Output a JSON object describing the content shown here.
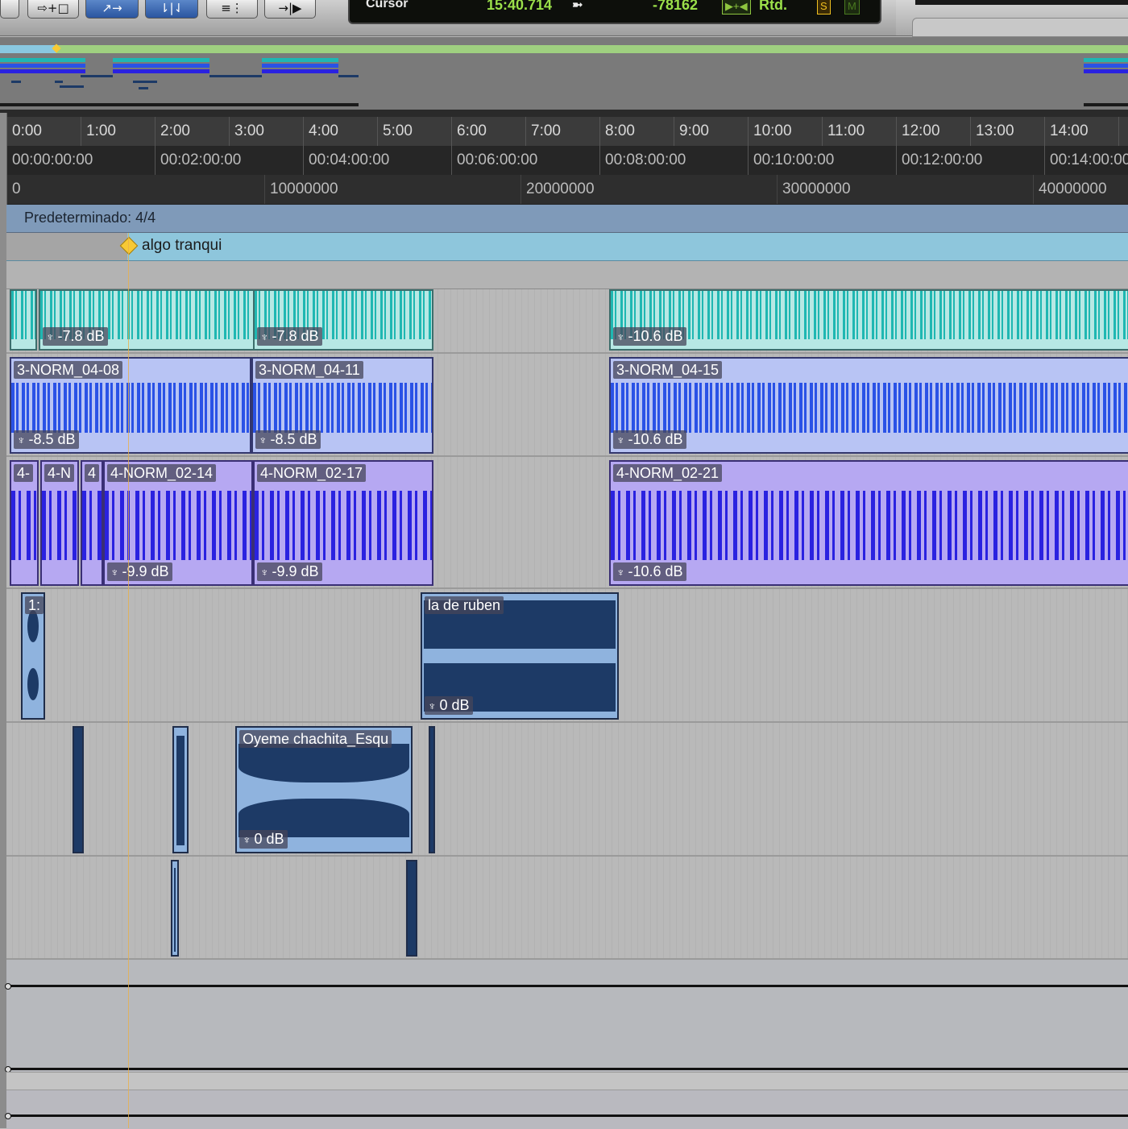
{
  "toolbar": {
    "buttons": [
      "⇨+□",
      "↗→",
      "⇂|⇃",
      "≡⋮",
      "→|▶"
    ]
  },
  "counter": {
    "label": "Cursor",
    "time": "15:40.714",
    "sample_value": "-78162",
    "badge_1": "▶+◀",
    "rtd": "Rtd.",
    "badge_s": "S",
    "badge_m": "M"
  },
  "rulers": {
    "minsecs": [
      "0:00",
      "1:00",
      "2:00",
      "3:00",
      "4:00",
      "5:00",
      "6:00",
      "7:00",
      "8:00",
      "9:00",
      "10:00",
      "11:00",
      "12:00",
      "13:00",
      "14:00"
    ],
    "timecode": [
      "00:00:00:00",
      "00:02:00:00",
      "00:04:00:00",
      "00:06:00:00",
      "00:08:00:00",
      "00:10:00:00",
      "00:12:00:00",
      "00:14:00:00"
    ],
    "samples": [
      "0",
      "10000000",
      "20000000",
      "30000000",
      "40000000"
    ]
  },
  "meter": "Predeterminado: 4/4",
  "marker": "algo tranqui",
  "tracks": {
    "track1": {
      "clips": [
        {
          "name": "",
          "gain": "-7.8 dB"
        },
        {
          "name": "",
          "gain": "-7.8 dB"
        },
        {
          "name": "",
          "gain": "-10.6 dB"
        }
      ]
    },
    "track2": {
      "clips": [
        {
          "name": "3-NORM_04-08",
          "gain": "-8.5 dB"
        },
        {
          "name": "3-NORM_04-11",
          "gain": "-8.5 dB"
        },
        {
          "name": "3-NORM_04-15",
          "gain": "-10.6 dB"
        }
      ]
    },
    "track3": {
      "clips": [
        {
          "name": "4-"
        },
        {
          "name": "4-N"
        },
        {
          "name": "4"
        },
        {
          "name": "4-NORM_02-14",
          "gain": "-9.9 dB"
        },
        {
          "name": "4-NORM_02-17",
          "gain": "-9.9 dB"
        },
        {
          "name": "4-NORM_02-21",
          "gain": "-10.6 dB"
        }
      ]
    },
    "track4": {
      "clips": [
        {
          "name": "1:"
        },
        {
          "name": "la de ruben",
          "gain": "0 dB"
        }
      ]
    },
    "track5": {
      "clips": [
        {
          "name": "Oyeme chachita_Esqu",
          "gain": "0 dB"
        }
      ]
    }
  },
  "colors": {
    "cyan_clip": "#b7e8e4",
    "blue_clip": "#b8c4f4",
    "violet_clip": "#b6a8f2",
    "navy_clip": "#8fb3de",
    "counter_green": "#9be04a",
    "marker_yellow": "#f7c934"
  },
  "icons": {
    "gain": "trim-handle-icon",
    "marker": "marker-diamond-icon"
  }
}
